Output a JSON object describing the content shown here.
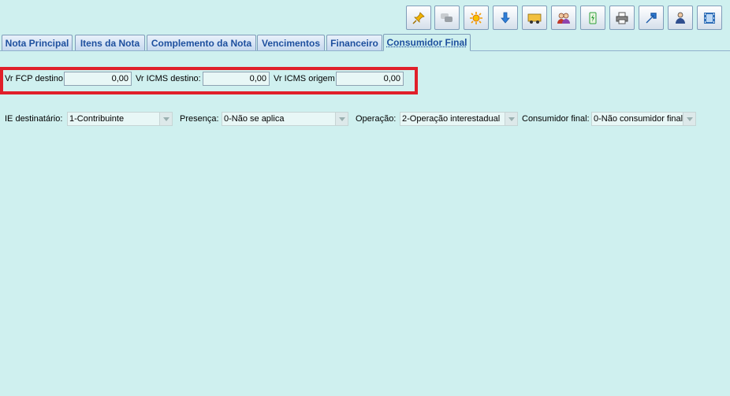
{
  "toolbar": {
    "buttons": [
      {
        "name": "pin-icon",
        "color": "#f0b400"
      },
      {
        "name": "chat-bubbles-icon",
        "color": "#9aa0a6"
      },
      {
        "name": "sun-icon",
        "color": "#f39b00"
      },
      {
        "name": "download-arrow-icon",
        "color": "#2f7fd8"
      },
      {
        "name": "truck-icon",
        "color": "#e0a020"
      },
      {
        "name": "users-icon",
        "color": "#c0392b"
      },
      {
        "name": "battery-icon",
        "color": "#2e9e3a"
      },
      {
        "name": "printer-icon",
        "color": "#555555"
      },
      {
        "name": "export-arrow-icon",
        "color": "#2f7fd8"
      },
      {
        "name": "person-icon",
        "color": "#2f4f8f"
      },
      {
        "name": "film-icon",
        "color": "#2f6fb8"
      }
    ]
  },
  "tabs": [
    {
      "label": "Nota Principal"
    },
    {
      "label": "Itens da Nota"
    },
    {
      "label": "Complemento da Nota"
    },
    {
      "label": "Vencimentos"
    },
    {
      "label": "Financeiro"
    },
    {
      "label": "Consumidor Final"
    }
  ],
  "values": {
    "fcp_destino_label": "Vr FCP destino",
    "fcp_destino_value": "0,00",
    "icms_destino_label": "Vr ICMS destino:",
    "icms_destino_value": "0,00",
    "icms_origem_label": "Vr ICMS origem",
    "icms_origem_value": "0,00"
  },
  "fields": {
    "ie_label": "IE destinatário:",
    "ie_value": "1-Contribuinte",
    "presenca_label": "Presença:",
    "presenca_value": "0-Não se aplica",
    "operacao_label": "Operação:",
    "operacao_value": "2-Operação interestadual",
    "consumidor_label": "Consumidor final:",
    "consumidor_value": "0-Não consumidor final"
  },
  "colors": {
    "background": "#cff0ef",
    "tab_text": "#1d4f9e",
    "highlight": "#e0202a"
  }
}
